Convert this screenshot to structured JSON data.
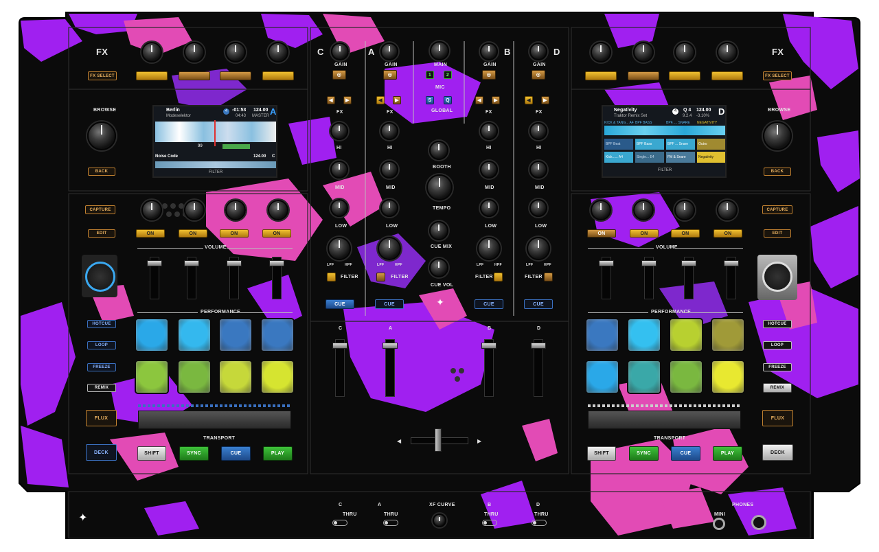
{
  "colors": {
    "purple": "#a020f0",
    "violet": "#8b2be2",
    "pink": "#e24bb5",
    "black": "#0b0b0b"
  },
  "fx_left": {
    "label": "FX",
    "select": "FX SELECT"
  },
  "fx_right": {
    "label": "FX",
    "select": "FX SELECT"
  },
  "browse_left": {
    "label": "BROWSE",
    "back": "BACK"
  },
  "browse_right": {
    "label": "BROWSE",
    "back": "BACK"
  },
  "screen_left": {
    "track": "Berlin",
    "artist": "Modeselektor",
    "deck_num": "4",
    "time_remain": "-01:53",
    "time_elapsed": "04:43",
    "bpm": "124.00",
    "master": "MASTER",
    "deck": "A",
    "beat": "99",
    "next_track": "Noise Code",
    "next_bpm": "124.00",
    "next_key": "C",
    "filter": "FILTER"
  },
  "screen_right": {
    "track": "Negativity",
    "subtitle": "Traktor Remix Set",
    "deck_num": "4",
    "key": "Q 4",
    "bpm": "124.00",
    "phase": "9.2.4",
    "pitch": "-3.10%",
    "deck": "D",
    "headers": [
      "KICK & TANG... A4",
      "BPF BASS",
      "BPF..... SNARE",
      "NEGATIVITY"
    ],
    "cells": [
      "BPF Beat",
      "BPF Bass",
      "BPF ... Snare",
      "Outro",
      "Kick...... A4",
      "Single... E4",
      "FM & Snare",
      "Negativity"
    ],
    "filter": "FILTER"
  },
  "left_unit": {
    "capture": "CAPTURE",
    "edit": "EDIT",
    "on": [
      "ON",
      "ON",
      "ON",
      "ON"
    ],
    "volume": "VOLUME",
    "performance": "PERFORMANCE",
    "hotcue": "HOTCUE",
    "loop": "LOOP",
    "freeze": "FREEZE",
    "remix": "REMIX",
    "flux": "FLUX",
    "deck": "DECK",
    "transport": "TRANSPORT",
    "shift": "SHIFT",
    "sync": "SYNC",
    "cue": "CUE",
    "play": "PLAY",
    "pads": [
      "#2aa8e8",
      "#34b8ee",
      "#3a78c0",
      "#3a78c0",
      "#8cc63e",
      "#7ab840",
      "#c6d83a",
      "#d6e430"
    ]
  },
  "right_unit": {
    "capture": "CAPTURE",
    "edit": "EDIT",
    "on": [
      "ON",
      "ON",
      "ON",
      "ON"
    ],
    "volume": "VOLUME",
    "performance": "PERFORMANCE",
    "hotcue": "HOTCUE",
    "loop": "LOOP",
    "freeze": "FREEZE",
    "remix": "REMIX",
    "flux": "FLUX",
    "deck": "DECK",
    "transport": "TRANSPORT",
    "shift": "SHIFT",
    "sync": "SYNC",
    "cue": "CUE",
    "play": "PLAY",
    "pads": [
      "#3a78c0",
      "#34c0f0",
      "#b8d030",
      "#a09a38",
      "#2aa8e8",
      "#3aa8a8",
      "#7ab840",
      "#e8e830"
    ]
  },
  "mixer": {
    "channels": [
      "C",
      "A",
      "B",
      "D"
    ],
    "gain": "GAIN",
    "main": "MAIN",
    "mic": "MIC",
    "mic_btns": [
      "1",
      "2"
    ],
    "global": "GLOBAL",
    "global_btns": [
      "S",
      "Q"
    ],
    "fx": "FX",
    "hi": "HI",
    "mid": "MID",
    "low": "LOW",
    "lpf": "LPF",
    "hpf": "HPF",
    "filter": "FILTER",
    "cue": "CUE",
    "booth": "BOOTH",
    "tempo": "TEMPO",
    "cue_mix": "CUE MIX",
    "cue_vol": "CUE VOL",
    "xf_curve": "XF CURVE",
    "thru": "THRU",
    "phones": "PHONES",
    "mini": "MINI"
  }
}
